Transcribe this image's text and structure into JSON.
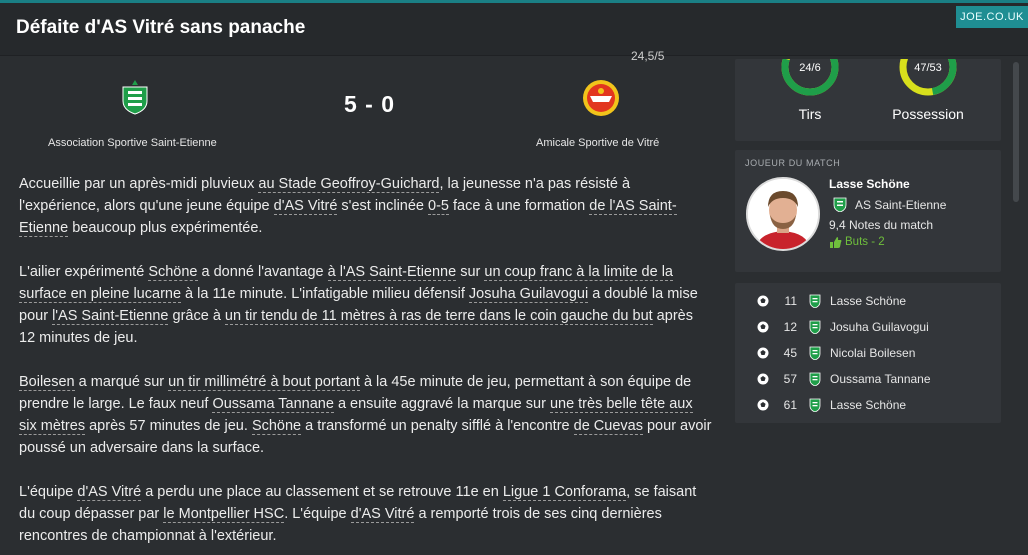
{
  "header": {
    "title": "Défaite d'AS Vitré sans panache",
    "brand": "JOE.CO.UK"
  },
  "match": {
    "attendance_partial": "24,5/5",
    "score": "5 - 0",
    "home_team": "Association Sportive Saint-Etienne",
    "away_team": "Amicale Sportive de Vitré"
  },
  "article": {
    "p1": [
      "Accueillie par un après-midi pluvieux ",
      "au Stade Geoffroy-Guichard",
      ", la jeunesse n'a pas résisté à l'expérience, alors qu'une jeune équipe ",
      "d'AS Vitré",
      " s'est inclinée ",
      "0-5",
      " face à une formation ",
      "de l'AS Saint-Etienne",
      " beaucoup plus expérimentée."
    ],
    "p2": [
      "L'ailier expérimenté ",
      "Schöne",
      " a donné l'avantage ",
      "à l'AS Saint-Etienne",
      " sur ",
      "un coup franc à la limite de la surface en pleine lucarne",
      " à la 11e minute. L'infatigable milieu défensif ",
      "Josuha Guilavogui",
      " a doublé la mise pour ",
      "l'AS Saint-Etienne",
      " grâce à ",
      "un tir tendu de 11 mètres à ras de terre dans le coin gauche du but",
      " après 12 minutes de jeu."
    ],
    "p3": [
      "Boilesen",
      " a marqué sur ",
      "un tir millimétré à bout portant",
      " à la 45e minute de jeu, permettant à son équipe de prendre le large. Le faux neuf ",
      "Oussama Tannane",
      " a ensuite aggravé la marque sur ",
      "une très belle tête aux six mètres",
      " après 57 minutes de jeu. ",
      "Schöne",
      " a transformé un penalty sifflé à l'encontre ",
      "de Cuevas",
      " pour avoir poussé un adversaire dans la surface."
    ],
    "p4": [
      "L'équipe ",
      "d'AS Vitré",
      " a perdu une place au classement et se retrouve 11e en ",
      "Ligue 1 Conforama",
      ", se faisant du coup dépasser par ",
      "le Montpellier HSC",
      ". L'équipe ",
      "d'AS Vitré",
      " a remporté trois de ses cinq dernières rencontres de championnat à l'extérieur."
    ]
  },
  "stats": {
    "shots": {
      "value": "24/6",
      "label": "Tirs",
      "home_fraction": 0.8
    },
    "possession": {
      "value": "47/53",
      "label": "Possession",
      "home_fraction": 0.47
    }
  },
  "motm": {
    "title": "JOUEUR DU MATCH",
    "name": "Lasse Schöne",
    "club": "AS Saint-Etienne",
    "rating": "9,4 Notes du match",
    "goals": "Buts - 2"
  },
  "goals": [
    {
      "minute": "11",
      "scorer": "Lasse Schöne"
    },
    {
      "minute": "12",
      "scorer": "Josuha Guilavogui"
    },
    {
      "minute": "45",
      "scorer": "Nicolai Boilesen"
    },
    {
      "minute": "57",
      "scorer": "Oussama Tannane"
    },
    {
      "minute": "61",
      "scorer": "Lasse Schöne"
    }
  ],
  "colors": {
    "accent": "#1f8e93",
    "home_green": "#1f9e49",
    "away_yellow": "#d8e01c",
    "rating_green": "#6fbf3c"
  },
  "icons": {
    "goal": "football-icon",
    "club": "asse-crest-icon",
    "thumb": "thumbs-up-icon"
  }
}
